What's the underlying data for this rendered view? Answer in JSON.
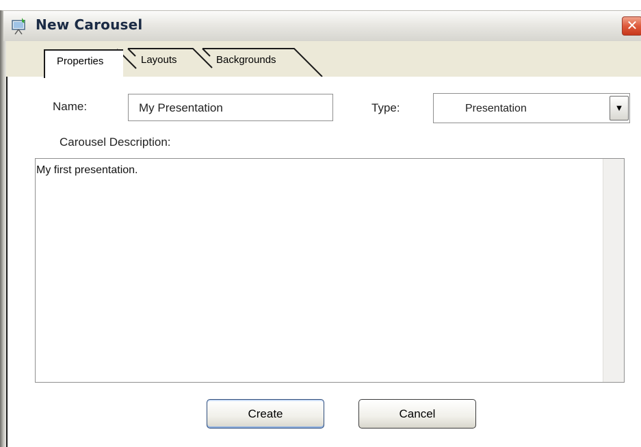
{
  "window": {
    "title": "New Carousel",
    "close_glyph": "✕"
  },
  "tabs": [
    {
      "label": "Properties",
      "selected": true
    },
    {
      "label": "Layouts",
      "selected": false
    },
    {
      "label": "Backgrounds",
      "selected": false
    }
  ],
  "form": {
    "name_label": "Name:",
    "name_value": "My Presentation",
    "type_label": "Type:",
    "type_value": "Presentation",
    "dropdown_glyph": "▼",
    "description_label": "Carousel Description:",
    "description_value": "My first presentation."
  },
  "buttons": {
    "create": "Create",
    "cancel": "Cancel"
  },
  "colors": {
    "titlebar": "#e9e8e3",
    "close": "#de5a3c",
    "tabstrip": "#ece9d8",
    "title_text": "#1a2a44"
  },
  "icons": {
    "app": "presentation-board-icon",
    "close": "close-icon",
    "dropdown": "chevron-down-icon"
  }
}
